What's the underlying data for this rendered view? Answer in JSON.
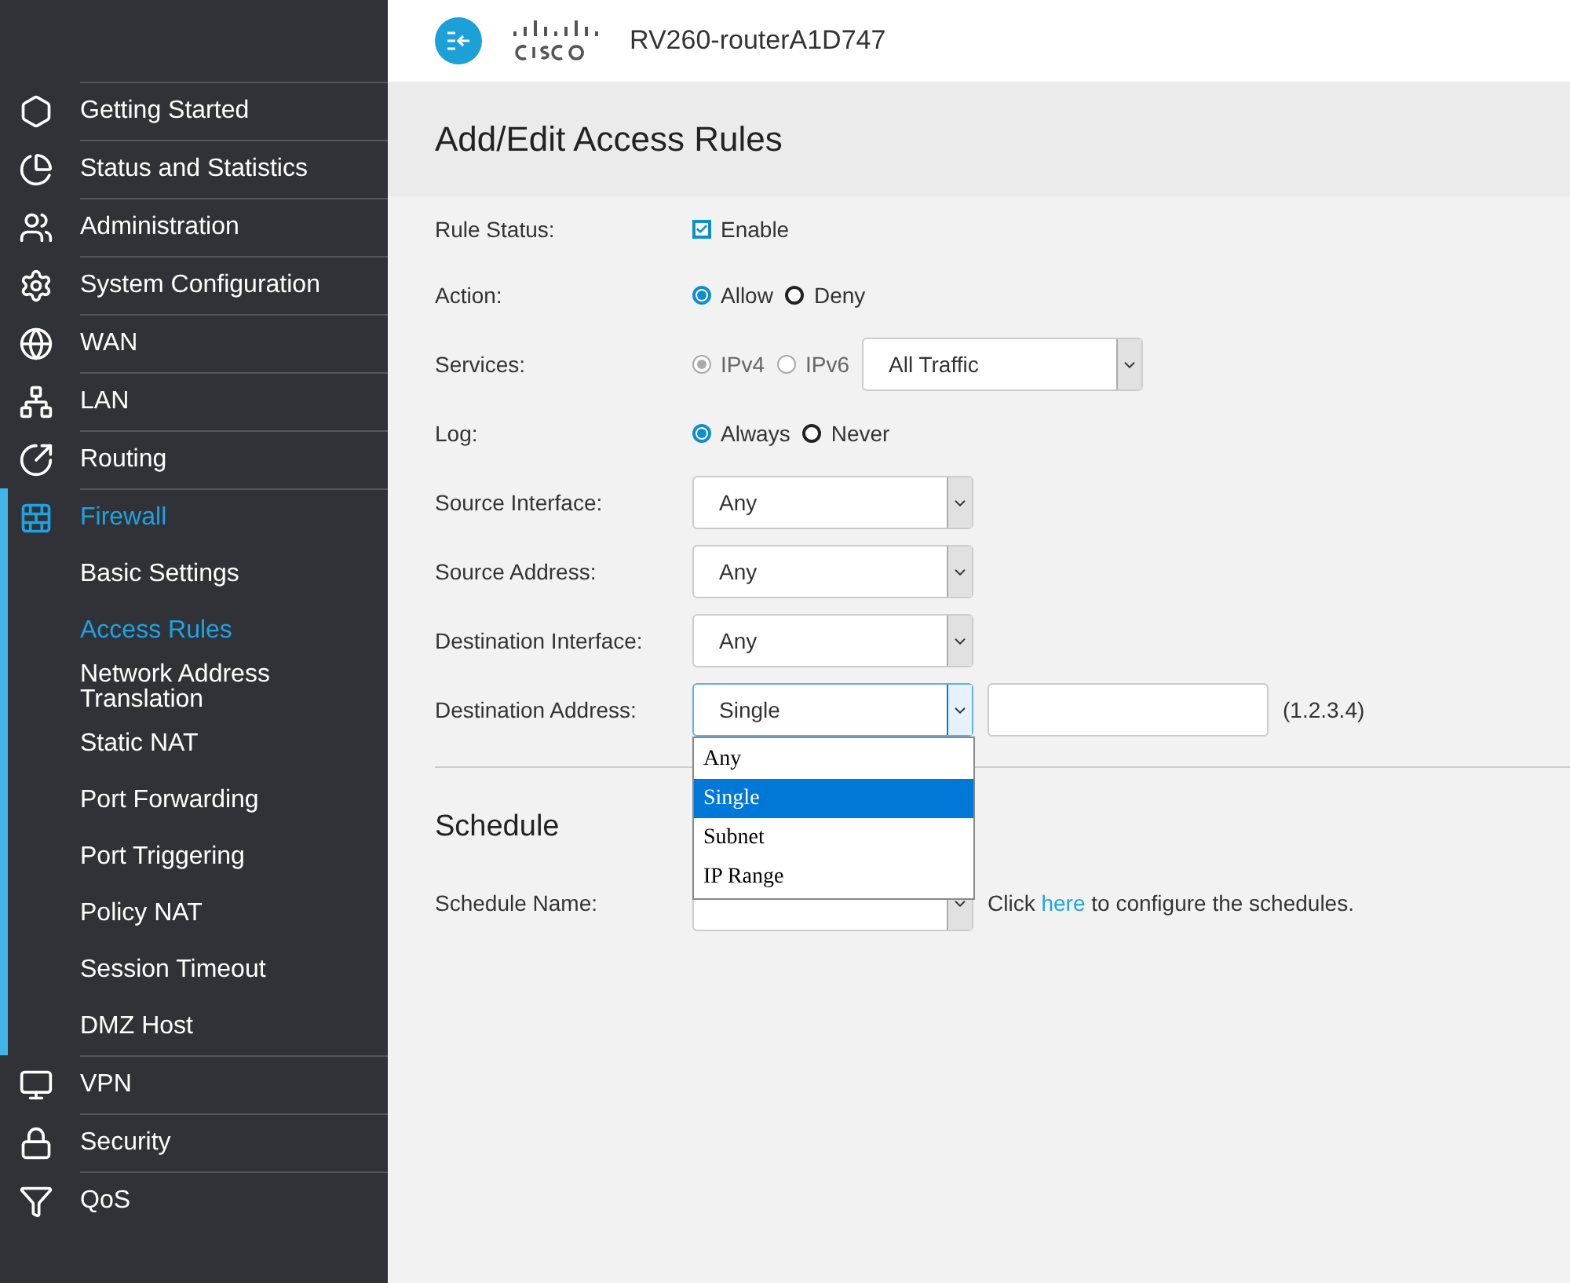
{
  "header": {
    "device_name": "RV260-routerA1D747"
  },
  "sidebar": {
    "items": [
      {
        "label": "Getting Started",
        "selected": false
      },
      {
        "label": "Status and Statistics",
        "selected": false
      },
      {
        "label": "Administration",
        "selected": false
      },
      {
        "label": "System Configuration",
        "selected": false
      },
      {
        "label": "WAN",
        "selected": false
      },
      {
        "label": "LAN",
        "selected": false
      },
      {
        "label": "Routing",
        "selected": false
      },
      {
        "label": "Firewall",
        "selected": true,
        "expanded": true,
        "children": [
          {
            "label": "Basic Settings",
            "selected": false
          },
          {
            "label": "Access Rules",
            "selected": true
          },
          {
            "label": "Network Address Translation",
            "selected": false
          },
          {
            "label": "Static NAT",
            "selected": false
          },
          {
            "label": "Port Forwarding",
            "selected": false
          },
          {
            "label": "Port Triggering",
            "selected": false
          },
          {
            "label": "Policy NAT",
            "selected": false
          },
          {
            "label": "Session Timeout",
            "selected": false
          },
          {
            "label": "DMZ Host",
            "selected": false
          }
        ]
      },
      {
        "label": "VPN",
        "selected": false
      },
      {
        "label": "Security",
        "selected": false
      },
      {
        "label": "QoS",
        "selected": false
      }
    ]
  },
  "page_title": "Add/Edit Access Rules",
  "form": [
    {
      "kind": "checkbox",
      "label": "Rule Status:",
      "option": "Enable",
      "checked": true
    },
    {
      "kind": "radio",
      "label": "Action:",
      "options": [
        {
          "label": "Allow",
          "selected": true,
          "disabled": false
        },
        {
          "label": "Deny",
          "selected": false,
          "disabled": false
        }
      ]
    },
    {
      "kind": "radio_select",
      "label": "Services:",
      "options": [
        {
          "label": "IPv4",
          "selected": true,
          "disabled": true
        },
        {
          "label": "IPv6",
          "selected": false,
          "disabled": true
        }
      ],
      "value": "All Traffic"
    },
    {
      "kind": "radio",
      "label": "Log:",
      "options": [
        {
          "label": "Always",
          "selected": true,
          "disabled": false
        },
        {
          "label": "Never",
          "selected": false,
          "disabled": false
        }
      ]
    },
    {
      "kind": "select",
      "label": "Source Interface:",
      "value": "Any",
      "open": false
    },
    {
      "kind": "select",
      "label": "Source Address:",
      "value": "Any",
      "open": false
    },
    {
      "kind": "select",
      "label": "Destination Interface:",
      "value": "Any",
      "open": false
    },
    {
      "kind": "select_input",
      "label": "Destination Address:",
      "value": "Single",
      "open": true,
      "hint": "(1.2.3.4)",
      "options": [
        {
          "label": "Any",
          "selected": false
        },
        {
          "label": "Single",
          "selected": true
        },
        {
          "label": "Subnet",
          "selected": false
        },
        {
          "label": "IP Range",
          "selected": false
        }
      ]
    }
  ],
  "schedule": {
    "heading": "Schedule",
    "label": "Schedule Name:",
    "note_before": "Click",
    "link": "here",
    "note_after": "to configure the schedules."
  }
}
